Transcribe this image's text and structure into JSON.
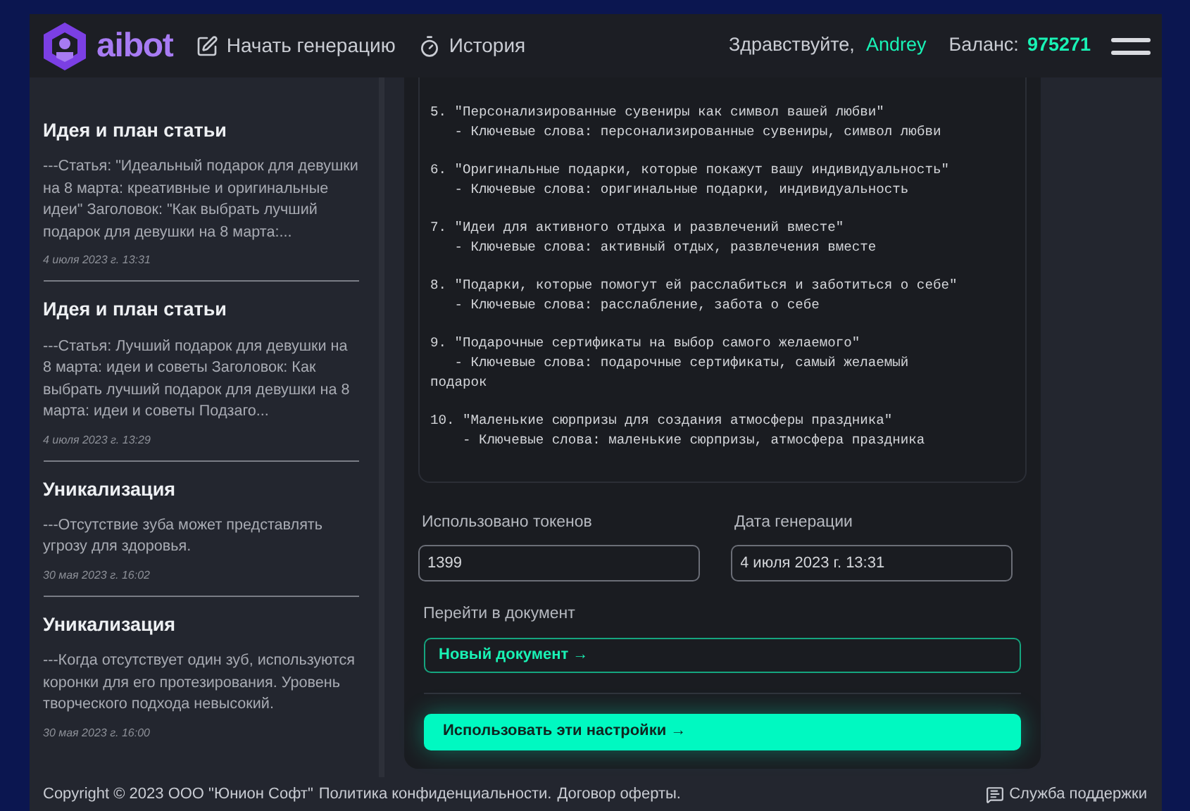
{
  "header": {
    "logo": "aibot",
    "nav": [
      {
        "label": "Начать генерацию",
        "kind": "edit"
      },
      {
        "label": "История",
        "kind": "history"
      }
    ],
    "greeting": "Здравствуйте,",
    "user": "Andrey",
    "balance_label": "Баланс:",
    "balance": "975271"
  },
  "history": [
    {
      "title": "Идея и план статьи",
      "excerpt": "---Статья: \"Идеальный подарок для девушки на 8 марта: креативные и оригинальные идеи\" Заголовок: \"Как выбрать лучший подарок для девушки на 8 марта:...",
      "date": "4 июля 2023 г. 13:31"
    },
    {
      "title": "Идея и план статьи",
      "excerpt": "---Статья: Лучший подарок для девушки на 8 марта: идеи и советы Заголовок: Как выбрать лучший подарок для девушки на 8 марта: идеи и советы Подзаго...",
      "date": "4 июля 2023 г. 13:29"
    },
    {
      "title": "Уникализация",
      "excerpt": "---Отсутствие зуба может представлять угрозу для здоровья.",
      "date": "30 мая 2023 г. 16:02"
    },
    {
      "title": "Уникализация",
      "excerpt": "---Когда отсутствует один зуб, используются коронки для его протезирования. Уровень творческого подхода невысокий.",
      "date": "30 мая 2023 г. 16:00"
    }
  ],
  "output_text": "5. \"Персонализированные сувениры как символ вашей любви\"\n   - Ключевые слова: персонализированные сувениры, символ любви\n\n6. \"Оригинальные подарки, которые покажут вашу индивидуальность\"\n   - Ключевые слова: оригинальные подарки, индивидуальность\n\n7. \"Идеи для активного отдыха и развлечений вместе\"\n   - Ключевые слова: активный отдых, развлечения вместе\n\n8. \"Подарки, которые помогут ей расслабиться и заботиться о себе\"\n   - Ключевые слова: расслабление, забота о себе\n\n9. \"Подарочные сертификаты на выбор самого желаемого\"\n   - Ключевые слова: подарочные сертификаты, самый желаемый\nподарок\n\n10. \"Маленькие сюрпризы для создания атмосферы праздника\"\n    - Ключевые слова: маленькие сюрпризы, атмосфера праздника",
  "fields": [
    {
      "label": "Использовано токенов",
      "value": "1399"
    },
    {
      "label": "Дата генерации",
      "value": "4 июля 2023 г. 13:31"
    }
  ],
  "document": {
    "label": "Перейти в документ",
    "link": "Новый документ →"
  },
  "apply_button": "Использовать эти настройки →",
  "footer": {
    "copyright": "Copyright © 2023 ООО \"Юнион Софт\"",
    "links": [
      "Политика конфиденциальности.",
      "Договор оферты."
    ],
    "support": "Служба поддержки"
  }
}
